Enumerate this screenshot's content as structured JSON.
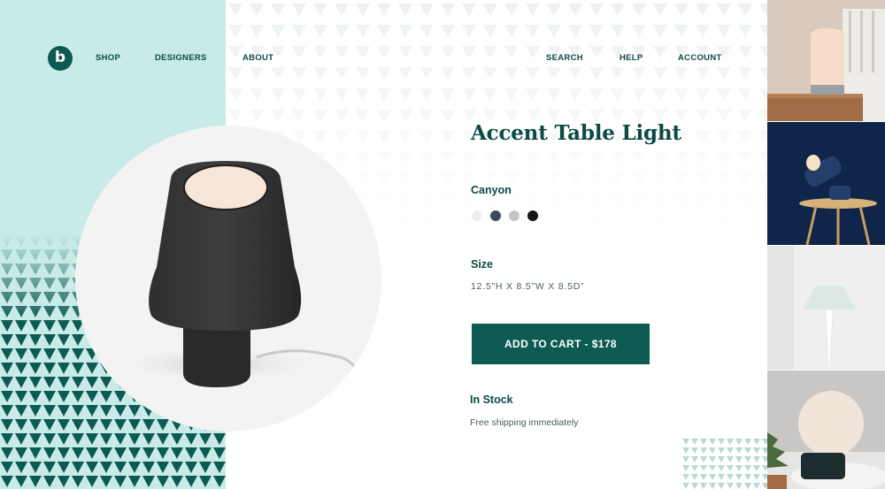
{
  "nav": {
    "logo_letter": "b",
    "shop": "SHOP",
    "designers": "DESIGNERS",
    "about": "ABOUT",
    "search": "SEARCH",
    "help": "HELP",
    "account": "ACCOUNT"
  },
  "product": {
    "title": "Accent Table Light",
    "color_label": "Canyon",
    "swatches": [
      "#eeeeee",
      "#3c4a5e",
      "#c3c6cc",
      "#151515"
    ],
    "size_label": "Size",
    "dimensions": "12.5”H  X  8.5”W  X  8.5D”",
    "cart_button": "ADD TO CART - $178",
    "stock_label": "In Stock",
    "shipping": "Free shipping immediately"
  },
  "colors": {
    "brand_green": "#0d5a52",
    "mint": "#c8ebe8"
  },
  "gallery": {
    "items": [
      "lamp-bedroom-thumbnail",
      "lamp-navy-thumbnail",
      "lamp-white-thumbnail",
      "lamp-globe-thumbnail"
    ]
  }
}
